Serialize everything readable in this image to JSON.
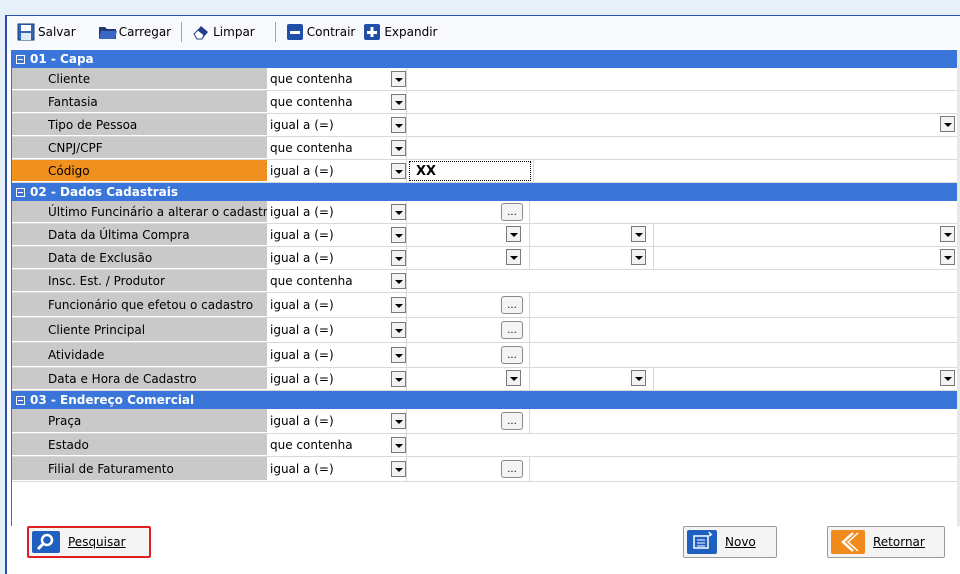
{
  "toolbar": {
    "save": "Salvar",
    "load": "Carregar",
    "clear": "Limpar",
    "collapse": "Contrair",
    "expand": "Expandir"
  },
  "sections": [
    {
      "title": "01 - Capa",
      "rows": [
        {
          "label": "Cliente",
          "operator": "que contenha"
        },
        {
          "label": "Fantasia",
          "operator": "que contenha"
        },
        {
          "label": "Tipo de Pessoa",
          "operator": "igual a (=)"
        },
        {
          "label": "CNPJ/CPF",
          "operator": "que contenha"
        },
        {
          "label": "Código",
          "operator": "igual a (=)",
          "value": "XX"
        }
      ]
    },
    {
      "title": "02 - Dados Cadastrais",
      "rows": [
        {
          "label": "Último Funcinário a alterar o cadastro",
          "operator": "igual a (=)"
        },
        {
          "label": "Data da Última Compra",
          "operator": "igual a (=)"
        },
        {
          "label": "Data de Exclusão",
          "operator": "igual a (=)"
        },
        {
          "label": "Insc. Est. / Produtor",
          "operator": "que contenha"
        },
        {
          "label": "Funcionário que efetou o cadastro",
          "operator": "igual a (=)"
        },
        {
          "label": "Cliente Principal",
          "operator": "igual a (=)"
        },
        {
          "label": "Atividade",
          "operator": "igual a (=)"
        },
        {
          "label": "Data e Hora de Cadastro",
          "operator": "igual a (=)"
        }
      ]
    },
    {
      "title": "03 - Endereço Comercial",
      "rows": [
        {
          "label": "Praça",
          "operator": "igual a (=)"
        },
        {
          "label": "Estado",
          "operator": "que contenha"
        },
        {
          "label": "Filial de Faturamento",
          "operator": "igual a (=)"
        }
      ]
    }
  ],
  "buttons": {
    "search": "Pesquisar",
    "new": "Novo",
    "back": "Retornar"
  },
  "ellipsis": "...",
  "colors": {
    "section_header": "#3a76d9",
    "label_bg": "#c9c9c9",
    "active_label": "#f0901e",
    "search_highlight": "#e02020"
  }
}
